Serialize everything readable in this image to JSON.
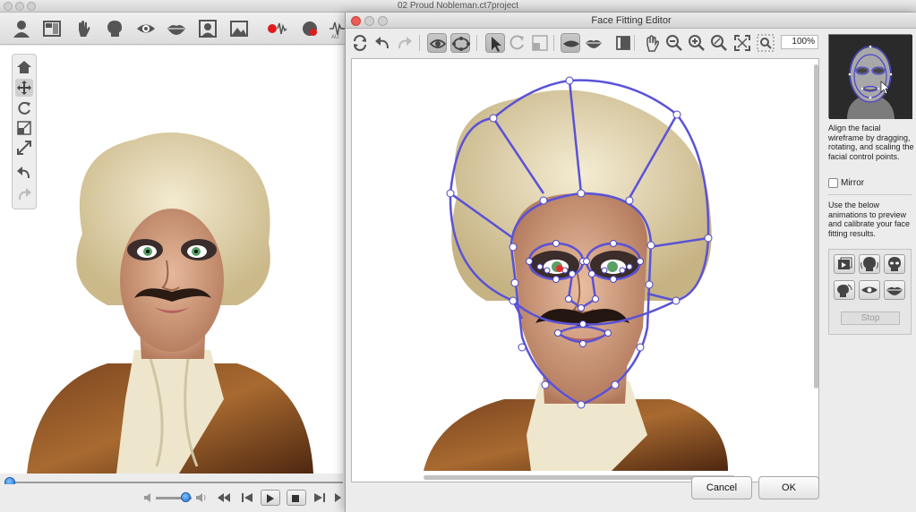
{
  "main_window": {
    "title": "02 Proud Nobleman.ct7project",
    "toolbar_icons": [
      "actor-icon",
      "layout-icon",
      "gesture-hand-icon",
      "head-icon",
      "eye-icon",
      "lips-icon",
      "face-portrait-icon",
      "image-icon",
      "record-audio-icon",
      "auto-animation-icon"
    ],
    "toolbar_cut_label": "AU",
    "side_tools": [
      "home-icon",
      "move-icon",
      "rotate-icon",
      "scale-icon",
      "fit-icon",
      "undo-icon",
      "redo-icon"
    ],
    "timeline_position": 0.0,
    "volume": 0.8
  },
  "editor": {
    "title": "Face Fitting Editor",
    "zoom": "100%",
    "instruction": "Align the facial wireframe by dragging, rotating, and scaling the facial control points.",
    "mirror_label": "Mirror",
    "mirror_checked": false,
    "animation_text": "Use the below animations to preview and calibrate your face fitting results.",
    "animation_buttons": [
      "preview-anim-1-icon",
      "preview-anim-2-icon",
      "preview-anim-3-icon",
      "preview-anim-4-icon",
      "preview-anim-5-icon",
      "preview-anim-6-icon"
    ],
    "stop_label": "Stop",
    "cancel_label": "Cancel",
    "ok_label": "OK"
  },
  "colors": {
    "wireframe": "#5a52d6",
    "control_point": "#ffffff",
    "accent_blue": "#1e6fd0",
    "hair": "#e8dcb8",
    "skin": "#d9a98a",
    "coat": "#6b3a1c"
  }
}
